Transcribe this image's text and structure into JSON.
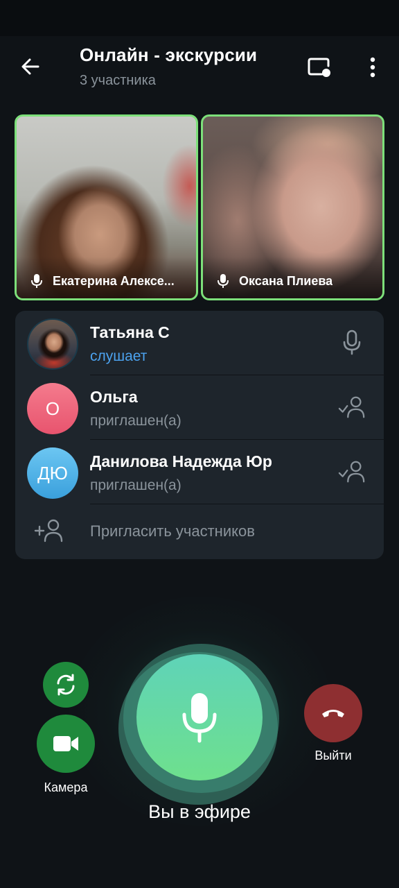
{
  "header": {
    "title": "Онлайн - экскурсии",
    "subtitle": "3 участника"
  },
  "video_tiles": [
    {
      "name": "Екатерина Алексе..."
    },
    {
      "name": "Оксана Плиева"
    }
  ],
  "participants": [
    {
      "name": "Татьяна С",
      "status": "слушает",
      "avatar_initials": ""
    },
    {
      "name": "Ольга",
      "status": "приглашен(а)",
      "avatar_initials": "О"
    },
    {
      "name": "Данилова Надежда Юр",
      "status": "приглашен(а)",
      "avatar_initials": "ДЮ"
    }
  ],
  "invite": {
    "label": "Пригласить участников"
  },
  "controls": {
    "camera_label": "Камера",
    "leave_label": "Выйти",
    "status_label": "Вы в эфире"
  },
  "colors": {
    "accent_green": "#7de07a",
    "live_blue": "#4ca3f0",
    "leave_red": "#8e2f31",
    "control_green": "#1f8a3c"
  }
}
